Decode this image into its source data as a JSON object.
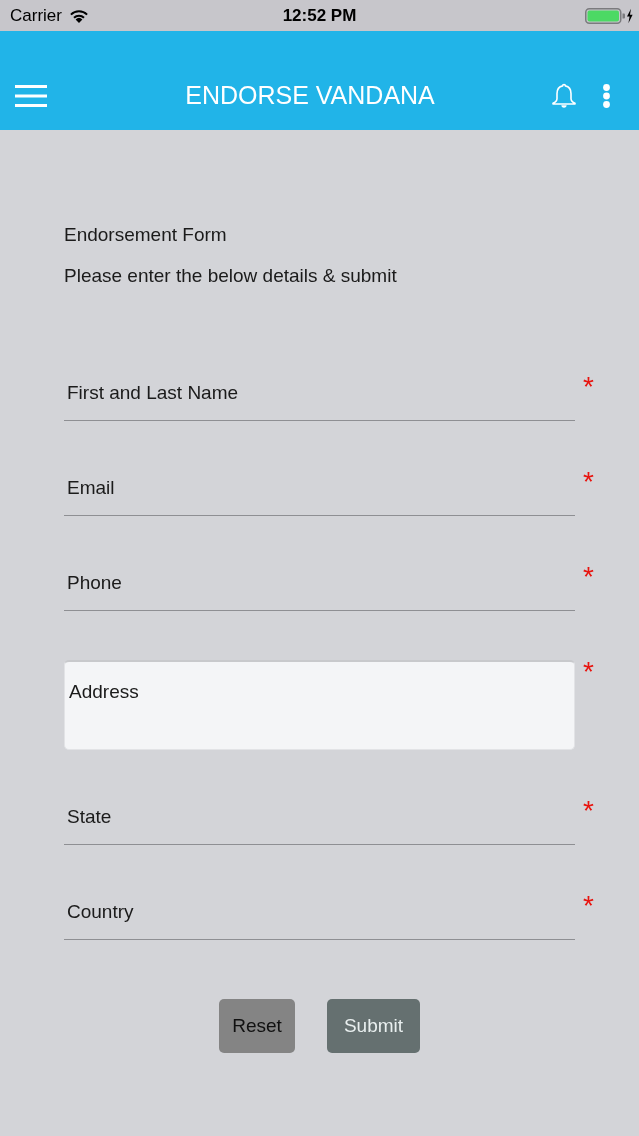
{
  "status_bar": {
    "carrier": "Carrier",
    "time": "12:52 PM"
  },
  "app_bar": {
    "title": "ENDORSE VANDANA"
  },
  "form": {
    "title": "Endorsement Form",
    "subtitle": "Please enter the below details & submit",
    "fields": [
      {
        "kind": "line",
        "placeholder": "First and Last Name",
        "required_mark": "*"
      },
      {
        "kind": "line",
        "placeholder": "Email",
        "required_mark": "*"
      },
      {
        "kind": "line",
        "placeholder": "Phone",
        "required_mark": "*"
      },
      {
        "kind": "box",
        "placeholder": "Address",
        "required_mark": "*"
      },
      {
        "kind": "line",
        "placeholder": "State",
        "required_mark": "*"
      },
      {
        "kind": "line",
        "placeholder": "Country",
        "required_mark": "*"
      }
    ],
    "buttons": [
      {
        "kind": "secondary",
        "label": "Reset"
      },
      {
        "kind": "primary",
        "label": "Submit"
      }
    ]
  }
}
